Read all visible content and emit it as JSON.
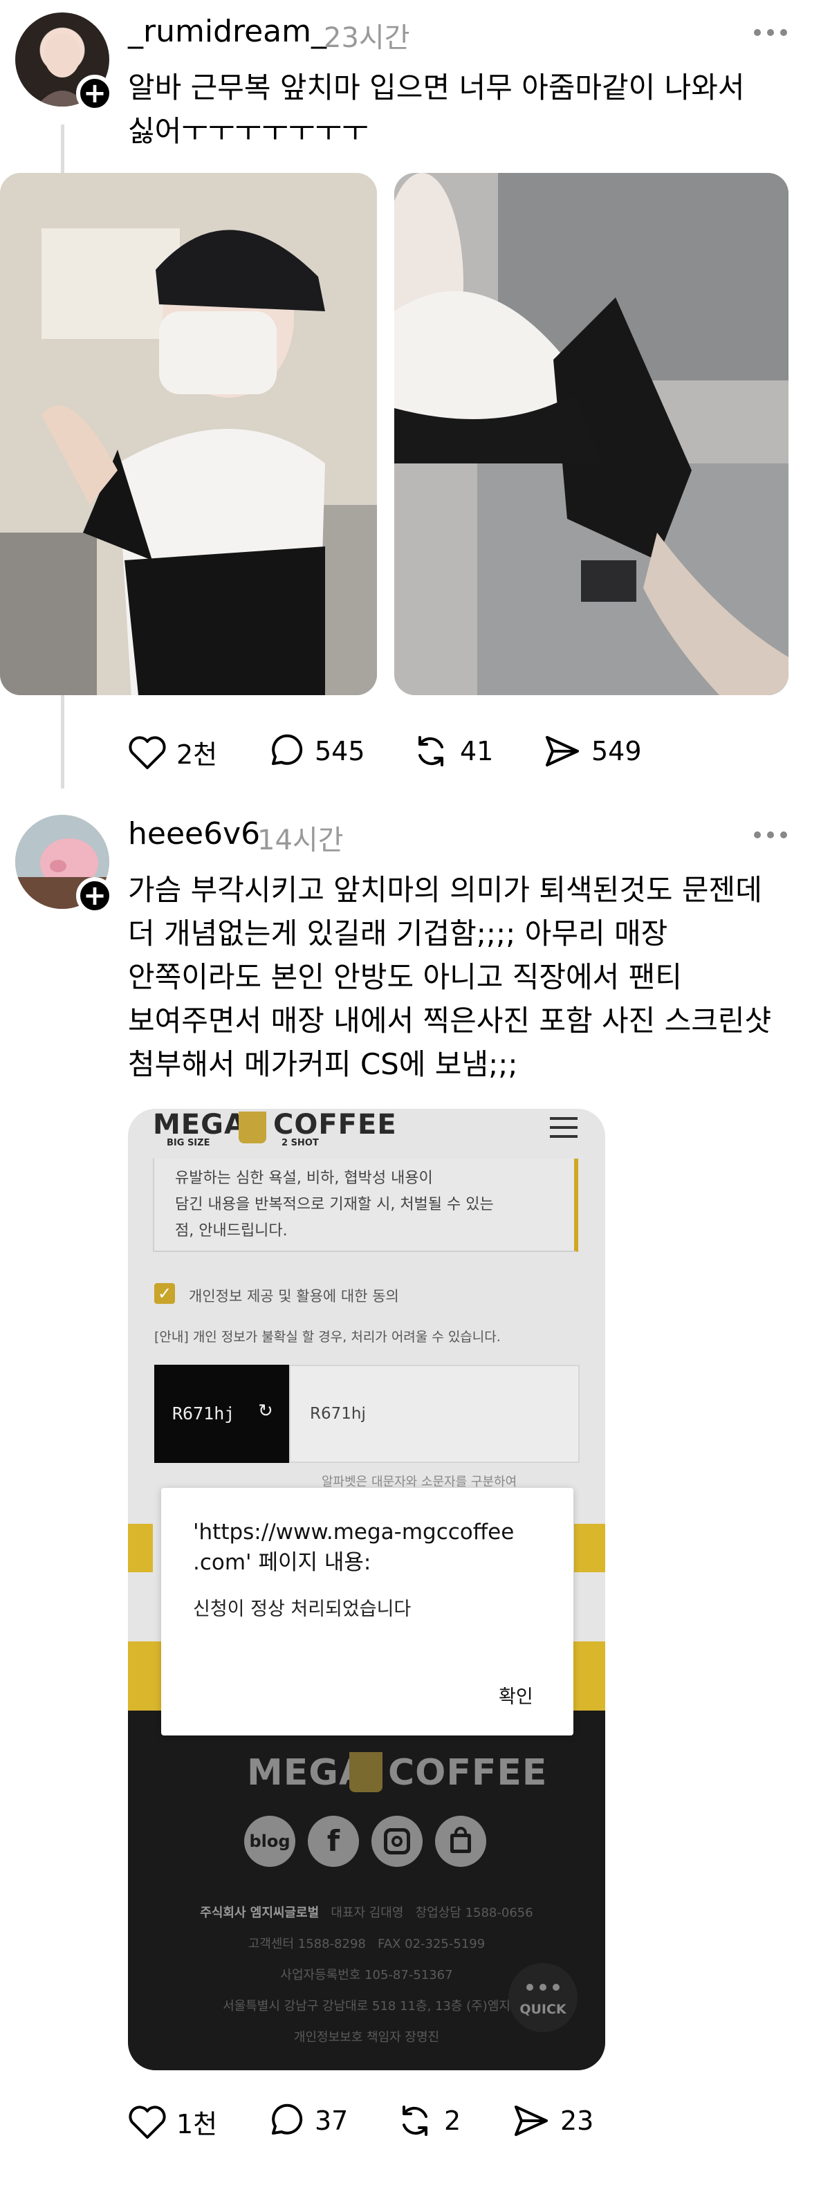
{
  "post1": {
    "username": "_rumidream_",
    "time": "23시간",
    "text": "알바 근무복 앞치마 입으면 너무 아줌마같이 나와서\n싫어ㅜㅜㅜㅜㅜㅜㅜ",
    "likes": "2천",
    "comments": "545",
    "reposts": "41",
    "shares": "549"
  },
  "post2": {
    "username": "heee6v6",
    "time": "14시간",
    "text": "가슴 부각시키고 앞치마의 의미가 퇴색된것도 문젠데\n더 개념없는게 있길래 기겁함;;;; 아무리 매장\n안쪽이라도 본인 안방도 아니고 직장에서 팬티\n보여주면서 매장 내에서 찍은사진 포함 사진 스크린샷\n첨부해서 메가커피 CS에 보냄;;;",
    "likes": "1천",
    "comments": "37",
    "reposts": "2",
    "shares": "23"
  },
  "screenshot": {
    "logo_left": "MEGA",
    "logo_right": "COFFEE",
    "logo_sub_left": "BIG SIZE",
    "logo_sub_right": "2 SHOT",
    "notice": "유발하는 심한 욕설, 비하, 협박성 내용이\n담긴 내용을 반복적으로 기재할 시, 처벌될 수 있는\n점, 안내드립니다.",
    "consent": "개인정보 제공 및 활용에 대한 동의",
    "guide": "[안내] 개인 정보가 불확실 할 경우, 처리가 어려울 수 있습니다.",
    "captcha_image": "R671hj",
    "captcha_input": "R671hj",
    "captcha_hint": "알파벳은 대문자와 소문자를 구분하여",
    "dialog_title": "'https://www.mega-mgccoffee\n.com' 페이지 내용:",
    "dialog_message": "신청이 정상 처리되었습니다",
    "dialog_ok": "확인",
    "footer_logo_left": "MEGA",
    "footer_logo_right": "COFFEE",
    "social_blog": "blog",
    "company": "주식회사 엠지씨글로벌",
    "ceo": "대표자 김대영",
    "startup": "창업상담 1588-0656",
    "support": "고객센터 1588-8298",
    "fax": "FAX 02-325-5199",
    "biz_no": "사업자등록번호 105-87-51367",
    "address": "서울특별시 강남구 강남대로 518 11층, 13층 (주)엠지",
    "privacy": "개인정보보호 책임자 장명진",
    "quick": "QUICK"
  }
}
